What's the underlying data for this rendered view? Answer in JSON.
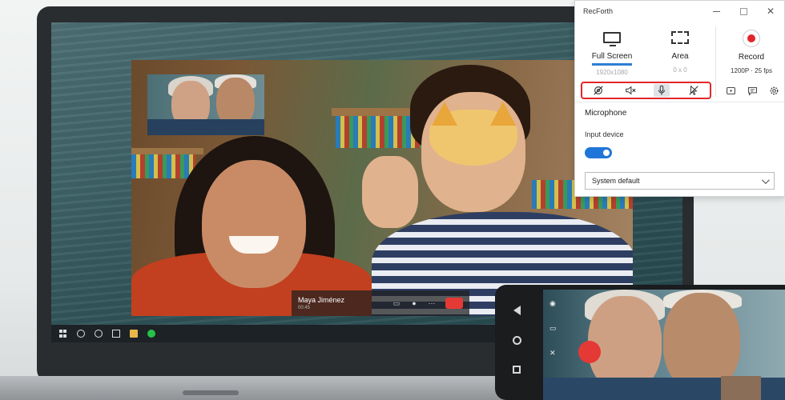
{
  "app": {
    "title": "RecForth"
  },
  "capture_modes": [
    {
      "label": "Full Screen",
      "sub": "1920x1080",
      "icon": "monitor-icon",
      "selected": true
    },
    {
      "label": "Area",
      "sub": "0 x 0",
      "icon": "area-select-icon",
      "selected": false
    }
  ],
  "record": {
    "label": "Record",
    "info": "1200P · 25 fps",
    "accent": "#e3262a"
  },
  "toggles": [
    {
      "icon": "webcam-off-icon",
      "active": false
    },
    {
      "icon": "speaker-muted-icon",
      "active": false
    },
    {
      "icon": "microphone-icon",
      "active": true
    },
    {
      "icon": "cursor-off-icon",
      "active": false
    }
  ],
  "extra_icons": [
    "video-files-icon",
    "chat-icon",
    "gear-icon"
  ],
  "microphone_panel": {
    "heading": "Microphone",
    "input_label": "Input device",
    "input_enabled": true,
    "device": "System default"
  },
  "call": {
    "caller_name": "Maya Jiménez",
    "caller_sub": "00:45"
  },
  "colors": {
    "accent_blue": "#2d7fd3",
    "toggle_on": "#2076d8",
    "highlight_box": "#e3262a",
    "hangup": "#e53935"
  }
}
